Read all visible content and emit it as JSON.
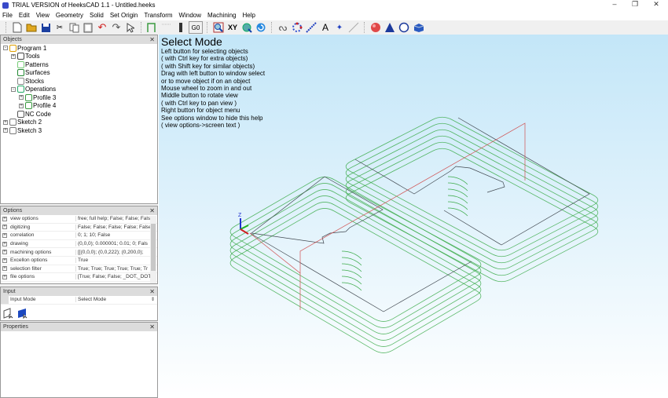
{
  "window": {
    "title": "TRIAL VERSION of HeeksCAD 1.1 - Untitled.heeks",
    "controls": [
      "minimize",
      "restore",
      "close"
    ]
  },
  "menu": [
    "File",
    "Edit",
    "View",
    "Geometry",
    "Solid",
    "Set Origin",
    "Transform",
    "Window",
    "Machining",
    "Help"
  ],
  "toolbar": {
    "icons": [
      "new-file-icon",
      "open-folder-icon",
      "save-icon",
      "cut-icon",
      "copy-icon",
      "paste-icon",
      "undo-icon",
      "redo-icon",
      "select-pointer-icon",
      "profile-icon",
      "pocket-icon",
      "drill-icon",
      "g0-icon",
      "view-zoom-icon",
      "xy-view-icon",
      "fit-view-icon",
      "rotate-view-icon",
      "sketch-icon",
      "circle-icon",
      "line-icon",
      "text-icon",
      "point-icon",
      "infinite-line-icon",
      "sphere-icon",
      "cone-icon",
      "cylinder-icon",
      "cuboid-icon"
    ],
    "g0_label": "G0",
    "xy_label": "XY",
    "text_label": "A"
  },
  "objects_panel": {
    "title": "Objects",
    "items": [
      {
        "label": "Program 1",
        "level": 0,
        "expander": "-"
      },
      {
        "label": "Tools",
        "level": 1,
        "expander": "+"
      },
      {
        "label": "Patterns",
        "level": 1,
        "expander": ""
      },
      {
        "label": "Surfaces",
        "level": 1,
        "expander": ""
      },
      {
        "label": "Stocks",
        "level": 1,
        "expander": ""
      },
      {
        "label": "Operations",
        "level": 1,
        "expander": "-"
      },
      {
        "label": "Profile 3",
        "level": 2,
        "expander": "+"
      },
      {
        "label": "Profile 4",
        "level": 2,
        "expander": "+"
      },
      {
        "label": "NC Code",
        "level": 1,
        "expander": ""
      },
      {
        "label": "Sketch 2",
        "level": 0,
        "expander": "+"
      },
      {
        "label": "Sketch 3",
        "level": 0,
        "expander": "+"
      }
    ]
  },
  "options_panel": {
    "title": "Options",
    "rows": [
      {
        "name": "view options",
        "value": "free; full help; False; False; Fals"
      },
      {
        "name": "digitizing",
        "value": "False; False; False; False; False"
      },
      {
        "name": "correlation",
        "value": "0; 1; 10; False"
      },
      {
        "name": "drawing",
        "value": "(0,0,0); 0.000001; 0.01; 0; Fals"
      },
      {
        "name": "machining options",
        "value": "[[(0,0,0); (0,0,222); (0,200,0);"
      },
      {
        "name": "Excellon options",
        "value": "True"
      },
      {
        "name": "selection filter",
        "value": "True; True; True; True; True; Tr"
      },
      {
        "name": "file options",
        "value": "[True; False; False; _DOT,_DOT"
      }
    ]
  },
  "input_panel": {
    "title": "Input",
    "name": "Input Mode",
    "value": "Select Mode"
  },
  "properties_panel": {
    "title": "Properties"
  },
  "viewport": {
    "heading": "Select Mode",
    "help_lines": [
      "Left button for selecting objects",
      "( with Ctrl key for extra objects)",
      "( with Shift key for similar objects)",
      "Drag with left button to window select",
      "or to move object if on an object",
      "Mouse wheel to zoom in and out",
      "Middle button to rotate view",
      "( with Ctrl key to pan view )",
      "Right button for object menu",
      "See options window to hide this help",
      "( view options->screen text )"
    ],
    "axis_label": "Z",
    "colors": {
      "toolpath": "#3cab4a",
      "part": "#404850",
      "rapid": "#d05050",
      "bg_top": "#c3e6f8"
    }
  }
}
